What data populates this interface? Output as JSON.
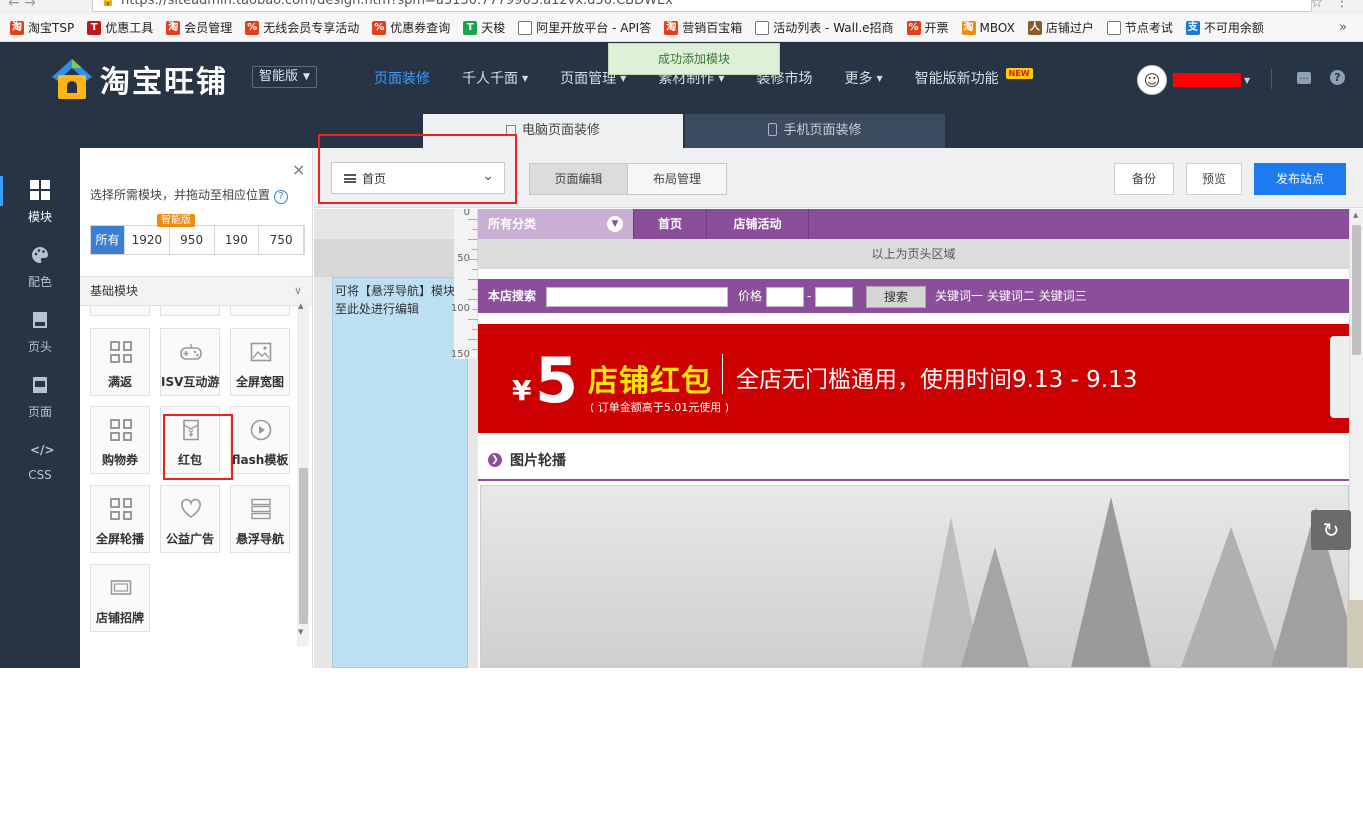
{
  "browser": {
    "url": "https://siteadmin.taobao.com/design.htm?spm=a3130.7779903.a12vx.d56.CBDWEx",
    "bookmarks": [
      {
        "label": "淘宝TSP",
        "icon": "taobao-icon"
      },
      {
        "label": "优惠工具",
        "icon": "tmall-icon"
      },
      {
        "label": "会员管理",
        "icon": "taobao-icon"
      },
      {
        "label": "无线会员专享活动",
        "icon": "coupon-icon"
      },
      {
        "label": "优惠券查询",
        "icon": "coupon-icon"
      },
      {
        "label": "天梭",
        "icon": "t-icon"
      },
      {
        "label": "阿里开放平台 - API答",
        "icon": "page-icon"
      },
      {
        "label": "营销百宝箱",
        "icon": "taobao-icon"
      },
      {
        "label": "活动列表 - Wall.e招商",
        "icon": "page-icon"
      },
      {
        "label": "开票",
        "icon": "coupon-icon"
      },
      {
        "label": "MBOX",
        "icon": "taobao-icon"
      },
      {
        "label": "店铺过户",
        "icon": "person-icon"
      },
      {
        "label": "节点考试",
        "icon": "page-icon"
      },
      {
        "label": "不可用余额",
        "icon": "alipay-icon"
      }
    ],
    "bookmarks_more": "»"
  },
  "topbar": {
    "brand": "淘宝旺铺",
    "edition": "智能版",
    "nav": [
      {
        "label": "页面装修",
        "active": true,
        "caret": false
      },
      {
        "label": "千人千面",
        "active": false,
        "caret": true
      },
      {
        "label": "页面管理",
        "active": false,
        "caret": true
      },
      {
        "label": "素材制作",
        "active": false,
        "caret": true
      },
      {
        "label": "装修市场",
        "active": false,
        "caret": false
      },
      {
        "label": "更多",
        "active": false,
        "caret": true
      },
      {
        "label": "智能版新功能",
        "active": false,
        "caret": false
      }
    ],
    "new_badge": "NEW",
    "toast": "成功添加模块"
  },
  "page_tabs": [
    {
      "label": "电脑页面装修",
      "active": true
    },
    {
      "label": "手机页面装修",
      "active": false
    }
  ],
  "sidebar": {
    "items": [
      {
        "label": "模块",
        "icon": "grid-icon",
        "active": true
      },
      {
        "label": "配色",
        "icon": "palette-icon",
        "active": false
      },
      {
        "label": "页头",
        "icon": "header-icon",
        "active": false
      },
      {
        "label": "页面",
        "icon": "page-layout-icon",
        "active": false
      },
      {
        "label": "CSS",
        "icon": "code-icon",
        "active": false
      }
    ]
  },
  "panel": {
    "close": "×",
    "tip": "选择所需模块，并拖动至相应位置",
    "help": "?",
    "filters": [
      "所有",
      "1920",
      "950",
      "190",
      "750"
    ],
    "smart_badge": "智能版",
    "section": "基础模块",
    "modules": [
      {
        "label": "满返",
        "icon": "grid-module-icon"
      },
      {
        "label": "ISV互动游",
        "icon": "gamepad-icon"
      },
      {
        "label": "全屏宽图",
        "icon": "image-icon"
      },
      {
        "label": "购物券",
        "icon": "grid-module-icon"
      },
      {
        "label": "红包",
        "icon": "red-envelope-icon"
      },
      {
        "label": "flash模板",
        "icon": "play-icon"
      },
      {
        "label": "全屏轮播",
        "icon": "grid-module-icon"
      },
      {
        "label": "公益广告",
        "icon": "heart-icon"
      },
      {
        "label": "悬浮导航",
        "icon": "float-nav-icon"
      },
      {
        "label": "店铺招牌",
        "icon": "signboard-icon"
      }
    ]
  },
  "toolbar": {
    "page_select": "首页",
    "modes": [
      "页面编辑",
      "布局管理"
    ],
    "backup": "备份",
    "preview": "预览",
    "publish": "发布站点"
  },
  "canvas": {
    "ruler": [
      "0",
      "50",
      "100",
      "150"
    ],
    "float_nav_hint": "可将【悬浮导航】模块至此处进行编辑",
    "store_nav": {
      "all": "所有分类",
      "items": [
        "首页",
        "店铺活动"
      ]
    },
    "header_hint": "以上为页头区域",
    "search": {
      "label": "本店搜索",
      "price": "价格",
      "dash": "-",
      "button": "搜索",
      "keywords": "关键词一  关键词二  关键词三"
    },
    "banner": {
      "currency": "¥",
      "amount": "5",
      "title": "店铺红包",
      "subtitle": "( 订单金额高于5.01元使用 )",
      "desc": "全店无门槛通用，使用时间9.13 - 9.13"
    },
    "carousel_title": "图片轮播"
  }
}
